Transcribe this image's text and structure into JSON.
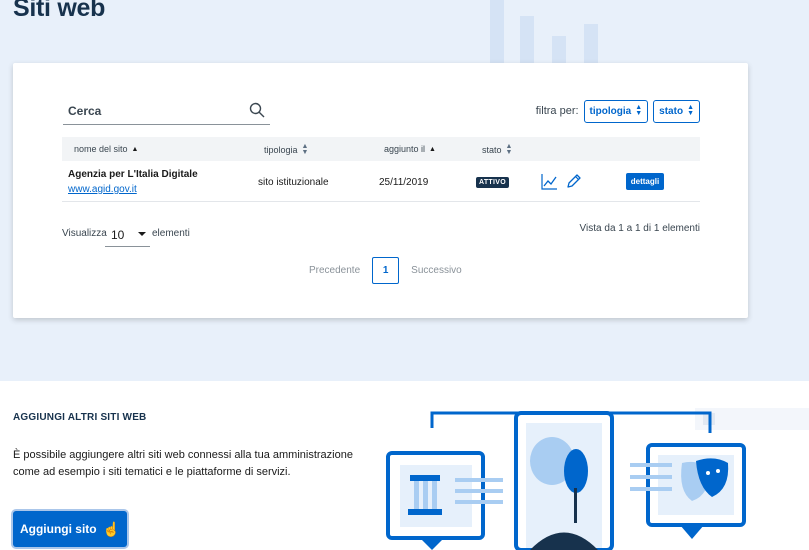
{
  "header": {
    "title": "Siti web"
  },
  "search": {
    "placeholder": "Cerca"
  },
  "filter": {
    "label": "filtra per:",
    "tipologia": "tipologia",
    "stato": "stato"
  },
  "table": {
    "columns": [
      "nome del sito",
      "tipologia",
      "aggiunto il",
      "stato"
    ],
    "rows": [
      {
        "name": "Agenzia per L'Italia Digitale",
        "url": "www.agid.gov.it",
        "tipologia": "sito istituzionale",
        "aggiunto": "25/11/2019",
        "stato": "ATTIVO",
        "details": "dettagli"
      }
    ]
  },
  "pagination": {
    "show_label": "Visualizza",
    "show_value": "10",
    "show_suffix": "elementi",
    "info": "Vista da 1 a 1 di 1 elementi",
    "prev": "Precedente",
    "page": "1",
    "next": "Successivo"
  },
  "add_section": {
    "title": "AGGIUNGI ALTRI SITI WEB",
    "description": "È possibile aggiungere altri siti web connessi alla tua amministrazione come ad esempio i siti tematici e le piattaforme di servizi.",
    "button": "Aggiungi sito"
  },
  "colors": {
    "primary": "#0066cc",
    "dark": "#17324d",
    "background": "#e8f0fa",
    "light_blue": "#a9cdf2"
  }
}
